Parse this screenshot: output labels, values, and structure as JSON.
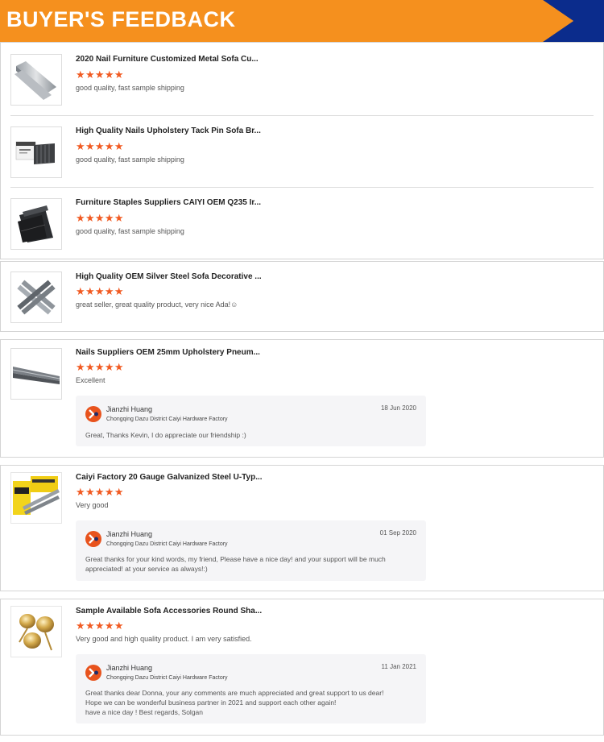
{
  "banner": {
    "title": "BUYER'S FEEDBACK",
    "accent": "#f5901e",
    "arrow_color": "#0b2c8c"
  },
  "star_color": "#f15a22",
  "reviews": [
    {
      "title": "2020 Nail Furniture Customized Metal Sofa Cu...",
      "stars": "★★★★★",
      "rating": 5,
      "comment": "good quality, fast sample shipping",
      "image": "silver-nail-strip"
    },
    {
      "title": "High Quality Nails Upholstery Tack Pin Sofa Br...",
      "stars": "★★★★★",
      "rating": 5,
      "comment": "good quality, fast sample shipping",
      "image": "boxed-staples"
    },
    {
      "title": "Furniture Staples Suppliers CAIYI OEM Q235 Ir...",
      "stars": "★★★★★",
      "rating": 5,
      "comment": "good quality, fast sample shipping",
      "image": "dark-staple-stack"
    },
    {
      "title": "High Quality OEM Silver Steel Sofa Decorative ...",
      "stars": "★★★★★",
      "rating": 5,
      "comment": "great seller, great quality product, very nice Ada!☺",
      "image": "crossed-staple-strips"
    },
    {
      "title": "Nails Suppliers OEM 25mm Upholstery Pneum...",
      "stars": "★★★★★",
      "rating": 5,
      "comment": "Excellent",
      "image": "long-nail-strip",
      "reply": {
        "name": "Jianzhi Huang",
        "company": "Chongqing Dazu District Caiyi Hardware Factory",
        "date": "18 Jun 2020",
        "lines": [
          "Great, Thanks Kevin, I do appreciate our friendship :)"
        ]
      }
    },
    {
      "title": "Caiyi Factory 20 Gauge Galvanized Steel U-Typ...",
      "stars": "★★★★★",
      "rating": 5,
      "comment": "Very good",
      "image": "yellow-box-staples",
      "reply": {
        "name": "Jianzhi Huang",
        "company": "Chongqing Dazu District Caiyi Hardware Factory",
        "date": "01 Sep 2020",
        "lines": [
          "Great thanks for your kind words, my friend, Please have a nice day! and your support will be much",
          "appreciated! at your service as always!:)"
        ]
      }
    },
    {
      "title": "Sample Available Sofa Accessories Round Sha...",
      "stars": "★★★★★",
      "rating": 5,
      "comment": "Very good and high quality product. I am very satisfied.",
      "image": "gold-upholstery-tacks",
      "reply": {
        "name": "Jianzhi Huang",
        "company": "Chongqing Dazu District Caiyi Hardware Factory",
        "date": "11 Jan 2021",
        "lines": [
          "Great thanks dear Donna, your any comments are much appreciated and great support to us dear!",
          "Hope we can be wonderful business partner in 2021 and support each other again!",
          "have a nice day ! Best regards, Solgan"
        ]
      }
    }
  ]
}
